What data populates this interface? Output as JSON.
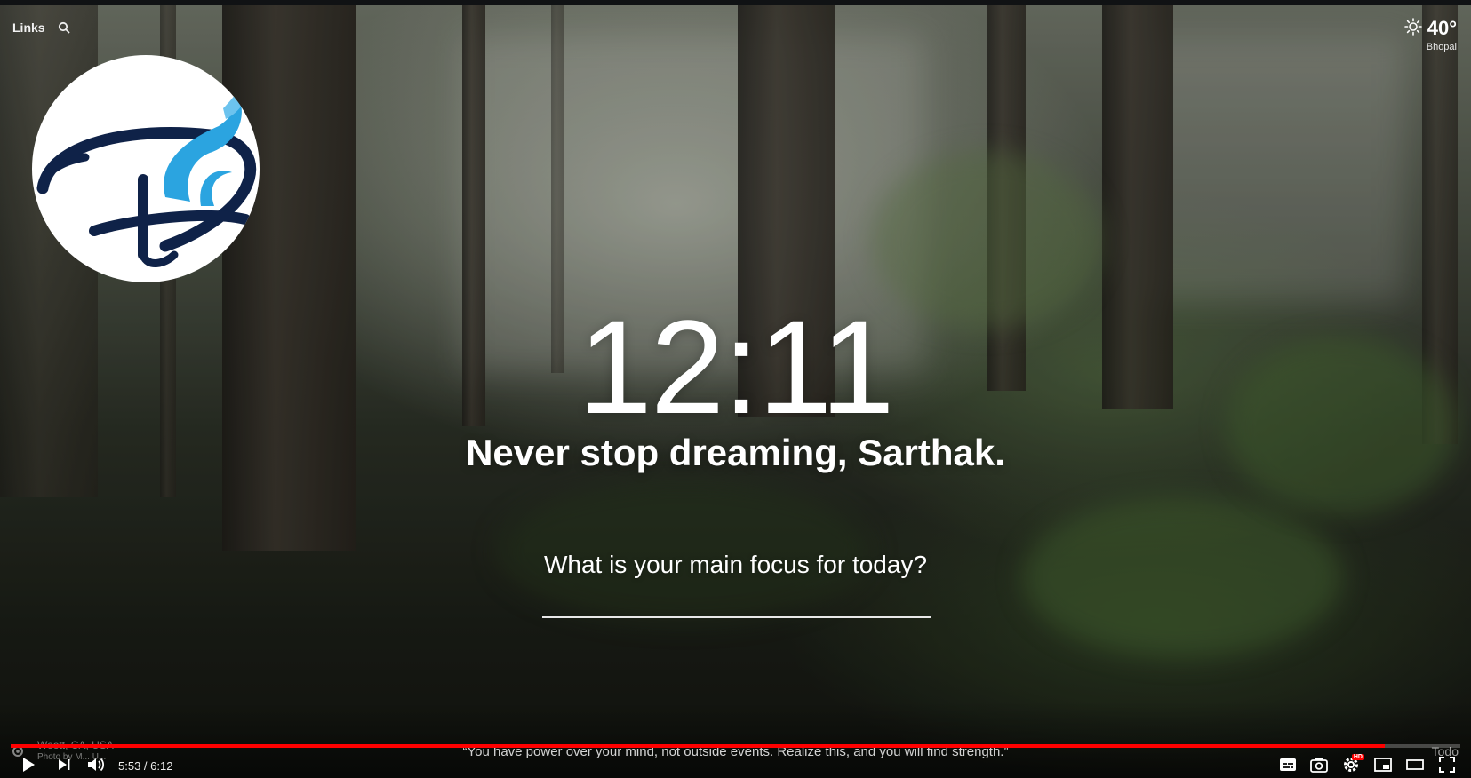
{
  "top_left": {
    "links_label": "Links"
  },
  "weather": {
    "temperature": "40°",
    "location": "Bhopal"
  },
  "clock": {
    "time": "12:11"
  },
  "greeting": {
    "text": "Never stop dreaming, Sarthak."
  },
  "focus": {
    "question": "What is your main focus for today?",
    "value": ""
  },
  "photo_info": {
    "location": "Weott, CA, USA",
    "credit": "Photo by M... U..."
  },
  "quote": {
    "text": "“You have power over your mind, not outside events. Realize this, and you will find strength.”"
  },
  "todo": {
    "label": "Todo"
  },
  "player": {
    "current_time": "5:53",
    "separator": " / ",
    "duration": "6:12",
    "progress": 0.948,
    "accent_color": "#ff0000",
    "hd_badge": "HD",
    "icons": [
      "play-icon",
      "next-icon",
      "volume-icon",
      "subtitles-icon",
      "screenshot-icon",
      "settings-icon",
      "miniplayer-icon",
      "theater-icon",
      "fullscreen-icon"
    ]
  }
}
